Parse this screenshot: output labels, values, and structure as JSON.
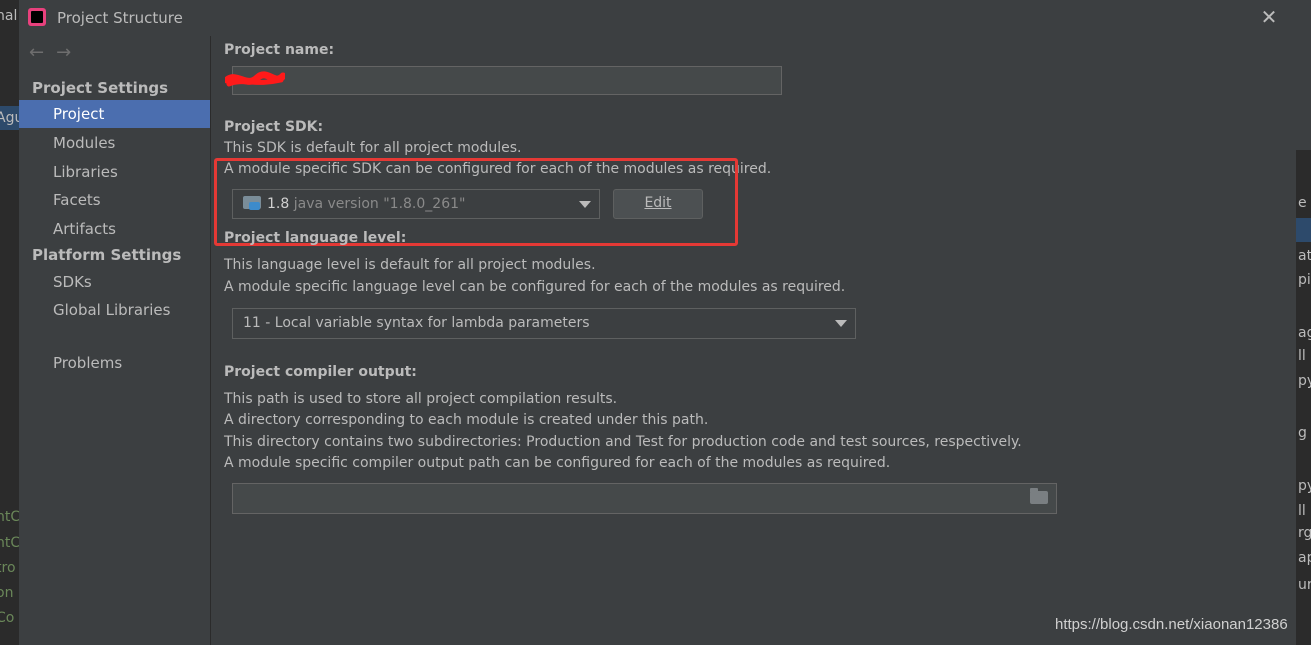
{
  "window": {
    "title": "Project Structure",
    "close_symbol": "✕"
  },
  "background": {
    "left_fragments": [
      "nal",
      "Agu",
      "ntC",
      "ntC",
      "tro",
      "on",
      "Co"
    ],
    "right_fragments": [
      "e",
      "at",
      "pil",
      "ag",
      "ll",
      "py",
      "g (",
      "py",
      "ll",
      "rg",
      "ap",
      "ur"
    ]
  },
  "sidebar": {
    "nav_back": "←",
    "nav_forward": "→",
    "project_settings_heading": "Project Settings",
    "platform_settings_heading": "Platform Settings",
    "items": [
      {
        "label": "Project",
        "active": true
      },
      {
        "label": "Modules"
      },
      {
        "label": "Libraries"
      },
      {
        "label": "Facets"
      },
      {
        "label": "Artifacts"
      },
      {
        "label": "SDKs"
      },
      {
        "label": "Global Libraries"
      },
      {
        "label": "Problems"
      }
    ]
  },
  "main": {
    "project_name_label": "Project name:",
    "project_name_value": "",
    "sdk_label": "Project SDK:",
    "sdk_desc1": "This SDK is default for all project modules.",
    "sdk_desc2": "A module specific SDK can be configured for each of the modules as required.",
    "sdk_version": "1.8",
    "sdk_detail": "java version \"1.8.0_261\"",
    "edit_button": "Edit",
    "language_label": "Project language level:",
    "language_desc1": "This language level is default for all project modules.",
    "language_desc2": "A module specific language level can be configured for each of the modules as required.",
    "language_value": "11 - Local variable syntax for lambda parameters",
    "compiler_label": "Project compiler output:",
    "compiler_desc1": "This path is used to store all project compilation results.",
    "compiler_desc2": "A directory corresponding to each module is created under this path.",
    "compiler_desc3": "This directory contains two subdirectories: Production and Test for production code and test sources, respectively.",
    "compiler_desc4": "A module specific compiler output path can be configured for each of the modules as required.",
    "compiler_output_value": ""
  },
  "watermark": "https://blog.csdn.net/xiaonan12386",
  "colors": {
    "accent": "#4b6eaf",
    "highlight": "#e53935",
    "background": "#3c3f41"
  }
}
